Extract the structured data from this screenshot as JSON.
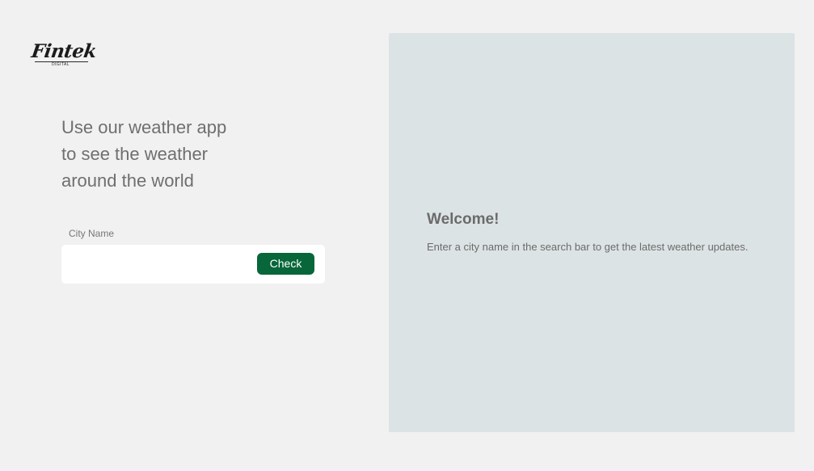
{
  "brand": {
    "logo_word": "Fintek",
    "logo_sub": "DIGITAL"
  },
  "intro": {
    "line1": "Use our weather app",
    "line2": "to see the weather",
    "line3": "around the world"
  },
  "search": {
    "label": "City Name",
    "value": "",
    "placeholder": "",
    "button_label": "Check"
  },
  "result_panel": {
    "title": "Welcome!",
    "message": "Enter a city name in the search bar to get the latest weather updates."
  },
  "colors": {
    "accent": "#07663a",
    "panel_background": "#dce3e4",
    "page_background": "#f1f1f1"
  }
}
